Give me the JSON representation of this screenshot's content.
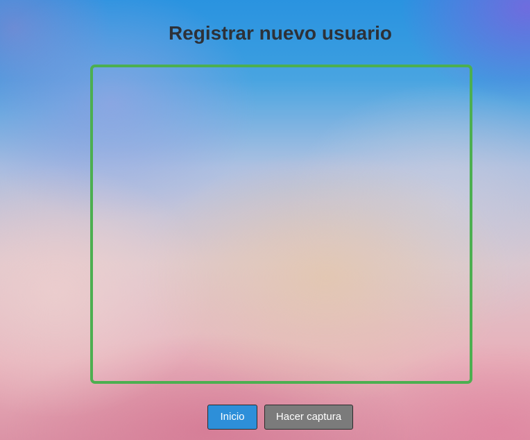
{
  "page": {
    "title": "Registrar nuevo usuario"
  },
  "camera": {
    "border_color": "#4caf50"
  },
  "actions": {
    "home_label": "Inicio",
    "capture_label": "Hacer captura",
    "home_color": "#2d8fd9",
    "capture_color": "#7b7b7b"
  }
}
